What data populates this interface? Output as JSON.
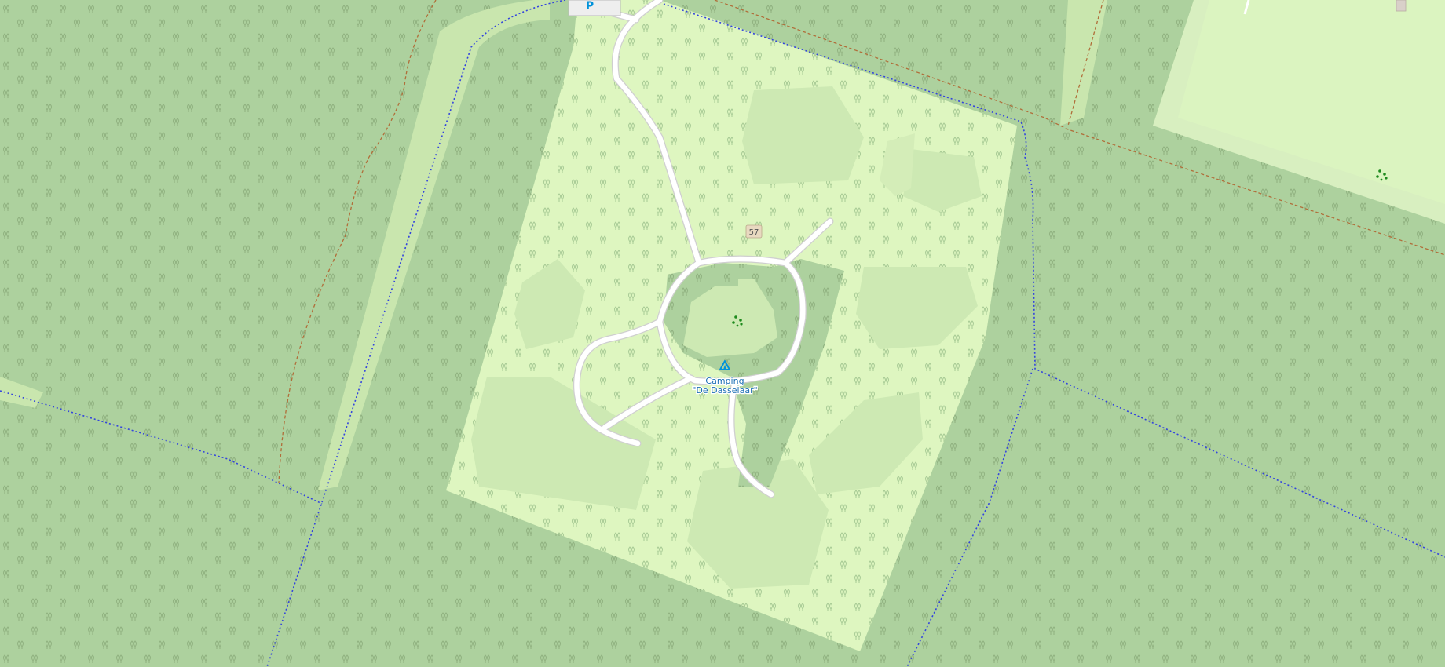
{
  "map": {
    "colors": {
      "forest": "#add19e",
      "grass": "#cdebb0",
      "camp_area": "#def6c0",
      "meadow": "#c9e6ae",
      "road": "#ffffff",
      "road_casing": "#cfcfcf",
      "path_blue": "#3344dd",
      "track_brown": "#b06e3a",
      "label_blue": "#1c6fb5",
      "tree_symbol": "#8fb07f",
      "poi_green": "#1e8a1e",
      "parking_bg": "#eeeeee"
    },
    "labels": {
      "campsite_line1": "Camping",
      "campsite_line2": "\"De Dasselaar\"",
      "house_number": "57",
      "parking_symbol": "P"
    },
    "icons": [
      "campsite-icon",
      "parking-icon",
      "playground-icon",
      "playground-icon-2",
      "tree-pattern"
    ]
  }
}
